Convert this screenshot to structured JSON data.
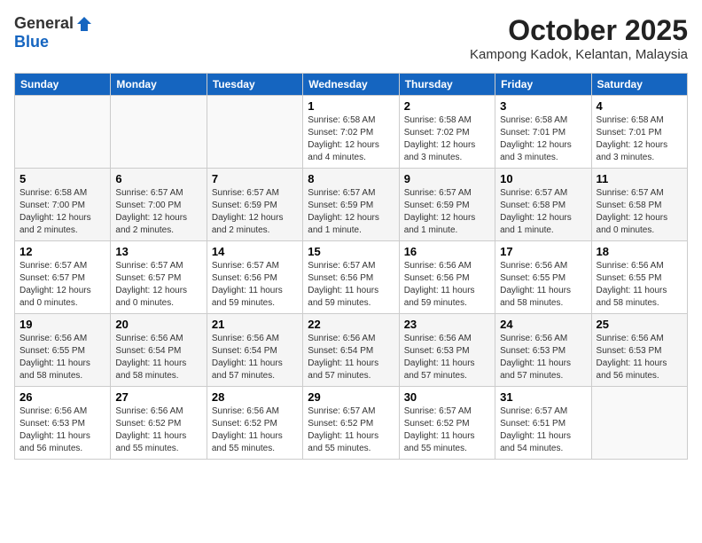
{
  "header": {
    "logo_general": "General",
    "logo_blue": "Blue",
    "month": "October 2025",
    "location": "Kampong Kadok, Kelantan, Malaysia"
  },
  "weekdays": [
    "Sunday",
    "Monday",
    "Tuesday",
    "Wednesday",
    "Thursday",
    "Friday",
    "Saturday"
  ],
  "weeks": [
    [
      {
        "day": "",
        "info": ""
      },
      {
        "day": "",
        "info": ""
      },
      {
        "day": "",
        "info": ""
      },
      {
        "day": "1",
        "info": "Sunrise: 6:58 AM\nSunset: 7:02 PM\nDaylight: 12 hours\nand 4 minutes."
      },
      {
        "day": "2",
        "info": "Sunrise: 6:58 AM\nSunset: 7:02 PM\nDaylight: 12 hours\nand 3 minutes."
      },
      {
        "day": "3",
        "info": "Sunrise: 6:58 AM\nSunset: 7:01 PM\nDaylight: 12 hours\nand 3 minutes."
      },
      {
        "day": "4",
        "info": "Sunrise: 6:58 AM\nSunset: 7:01 PM\nDaylight: 12 hours\nand 3 minutes."
      }
    ],
    [
      {
        "day": "5",
        "info": "Sunrise: 6:58 AM\nSunset: 7:00 PM\nDaylight: 12 hours\nand 2 minutes."
      },
      {
        "day": "6",
        "info": "Sunrise: 6:57 AM\nSunset: 7:00 PM\nDaylight: 12 hours\nand 2 minutes."
      },
      {
        "day": "7",
        "info": "Sunrise: 6:57 AM\nSunset: 6:59 PM\nDaylight: 12 hours\nand 2 minutes."
      },
      {
        "day": "8",
        "info": "Sunrise: 6:57 AM\nSunset: 6:59 PM\nDaylight: 12 hours\nand 1 minute."
      },
      {
        "day": "9",
        "info": "Sunrise: 6:57 AM\nSunset: 6:59 PM\nDaylight: 12 hours\nand 1 minute."
      },
      {
        "day": "10",
        "info": "Sunrise: 6:57 AM\nSunset: 6:58 PM\nDaylight: 12 hours\nand 1 minute."
      },
      {
        "day": "11",
        "info": "Sunrise: 6:57 AM\nSunset: 6:58 PM\nDaylight: 12 hours\nand 0 minutes."
      }
    ],
    [
      {
        "day": "12",
        "info": "Sunrise: 6:57 AM\nSunset: 6:57 PM\nDaylight: 12 hours\nand 0 minutes."
      },
      {
        "day": "13",
        "info": "Sunrise: 6:57 AM\nSunset: 6:57 PM\nDaylight: 12 hours\nand 0 minutes."
      },
      {
        "day": "14",
        "info": "Sunrise: 6:57 AM\nSunset: 6:56 PM\nDaylight: 11 hours\nand 59 minutes."
      },
      {
        "day": "15",
        "info": "Sunrise: 6:57 AM\nSunset: 6:56 PM\nDaylight: 11 hours\nand 59 minutes."
      },
      {
        "day": "16",
        "info": "Sunrise: 6:56 AM\nSunset: 6:56 PM\nDaylight: 11 hours\nand 59 minutes."
      },
      {
        "day": "17",
        "info": "Sunrise: 6:56 AM\nSunset: 6:55 PM\nDaylight: 11 hours\nand 58 minutes."
      },
      {
        "day": "18",
        "info": "Sunrise: 6:56 AM\nSunset: 6:55 PM\nDaylight: 11 hours\nand 58 minutes."
      }
    ],
    [
      {
        "day": "19",
        "info": "Sunrise: 6:56 AM\nSunset: 6:55 PM\nDaylight: 11 hours\nand 58 minutes."
      },
      {
        "day": "20",
        "info": "Sunrise: 6:56 AM\nSunset: 6:54 PM\nDaylight: 11 hours\nand 58 minutes."
      },
      {
        "day": "21",
        "info": "Sunrise: 6:56 AM\nSunset: 6:54 PM\nDaylight: 11 hours\nand 57 minutes."
      },
      {
        "day": "22",
        "info": "Sunrise: 6:56 AM\nSunset: 6:54 PM\nDaylight: 11 hours\nand 57 minutes."
      },
      {
        "day": "23",
        "info": "Sunrise: 6:56 AM\nSunset: 6:53 PM\nDaylight: 11 hours\nand 57 minutes."
      },
      {
        "day": "24",
        "info": "Sunrise: 6:56 AM\nSunset: 6:53 PM\nDaylight: 11 hours\nand 57 minutes."
      },
      {
        "day": "25",
        "info": "Sunrise: 6:56 AM\nSunset: 6:53 PM\nDaylight: 11 hours\nand 56 minutes."
      }
    ],
    [
      {
        "day": "26",
        "info": "Sunrise: 6:56 AM\nSunset: 6:53 PM\nDaylight: 11 hours\nand 56 minutes."
      },
      {
        "day": "27",
        "info": "Sunrise: 6:56 AM\nSunset: 6:52 PM\nDaylight: 11 hours\nand 55 minutes."
      },
      {
        "day": "28",
        "info": "Sunrise: 6:56 AM\nSunset: 6:52 PM\nDaylight: 11 hours\nand 55 minutes."
      },
      {
        "day": "29",
        "info": "Sunrise: 6:57 AM\nSunset: 6:52 PM\nDaylight: 11 hours\nand 55 minutes."
      },
      {
        "day": "30",
        "info": "Sunrise: 6:57 AM\nSunset: 6:52 PM\nDaylight: 11 hours\nand 55 minutes."
      },
      {
        "day": "31",
        "info": "Sunrise: 6:57 AM\nSunset: 6:51 PM\nDaylight: 11 hours\nand 54 minutes."
      },
      {
        "day": "",
        "info": ""
      }
    ]
  ]
}
